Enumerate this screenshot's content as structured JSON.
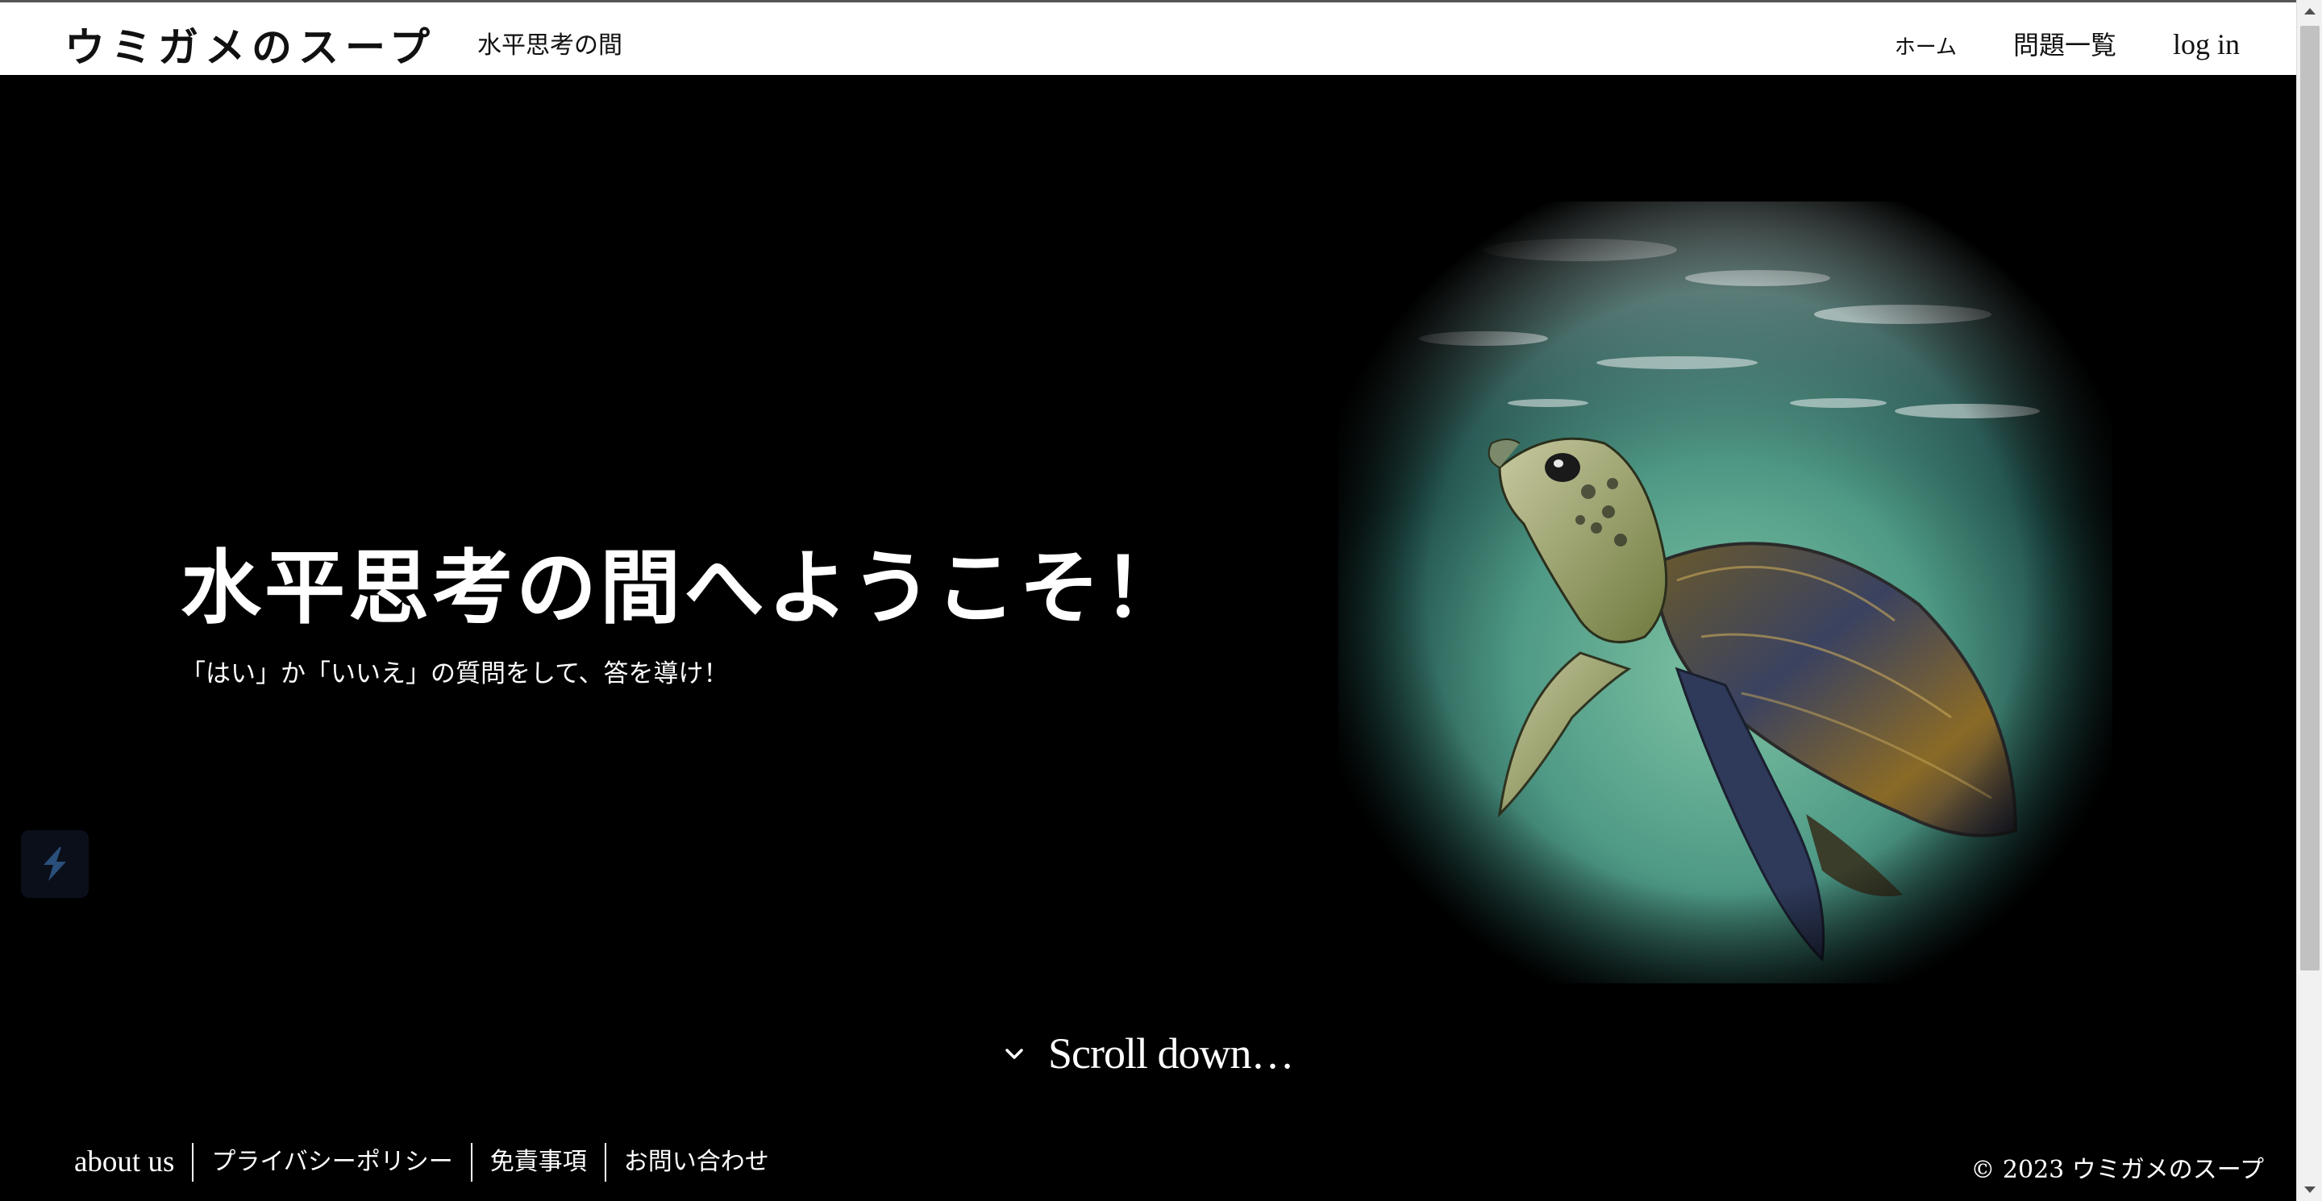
{
  "header": {
    "brand": "ウミガメのスープ",
    "tagline": "水平思考の間",
    "nav": {
      "home": "ホーム",
      "problems": "問題一覧",
      "login": "log in"
    }
  },
  "hero": {
    "title": "水平思考の間へようこそ！",
    "subtitle": "「はい」か「いいえ」の質問をして、答を導け！",
    "image_icon": "sea-turtle-illustration"
  },
  "scroll": {
    "label": "Scroll down…",
    "icon": "chevron-down-icon"
  },
  "footer": {
    "links": [
      "about us",
      "プライバシーポリシー",
      "免責事項",
      "お問い合わせ"
    ],
    "copyright": "© 2023 ウミガメのスープ"
  },
  "colors": {
    "background": "#000000",
    "header_bg": "#ffffff",
    "text_light": "#ffffff",
    "text_dark": "#111111"
  }
}
